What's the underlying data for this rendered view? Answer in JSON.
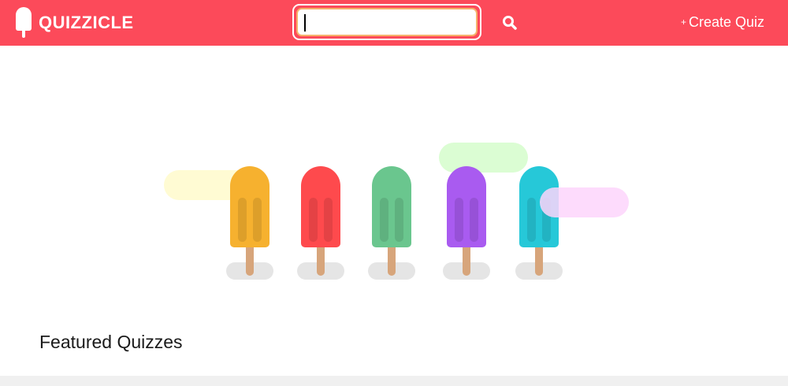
{
  "header": {
    "brand": "QUIZZICLE",
    "brand_icon": "popsicle-icon",
    "search": {
      "value": "",
      "placeholder": "",
      "icon": "search-icon"
    },
    "create_quiz": {
      "plus": "+",
      "label": "Create Quiz"
    }
  },
  "hero": {
    "popsicles": [
      {
        "color": "#f6b12f"
      },
      {
        "color": "#fe4a4d"
      },
      {
        "color": "#6ac68e"
      },
      {
        "color": "#a95bf0"
      },
      {
        "color": "#26c8d8"
      }
    ],
    "blob_colors": [
      "#fffbd3",
      "#dbfdd3",
      "#fdd5fb"
    ]
  },
  "main": {
    "featured_heading": "Featured Quizzes"
  },
  "colors": {
    "brand": "#fc4a5a",
    "search_border": "#f5b26b",
    "stick": "#d7a57b"
  }
}
